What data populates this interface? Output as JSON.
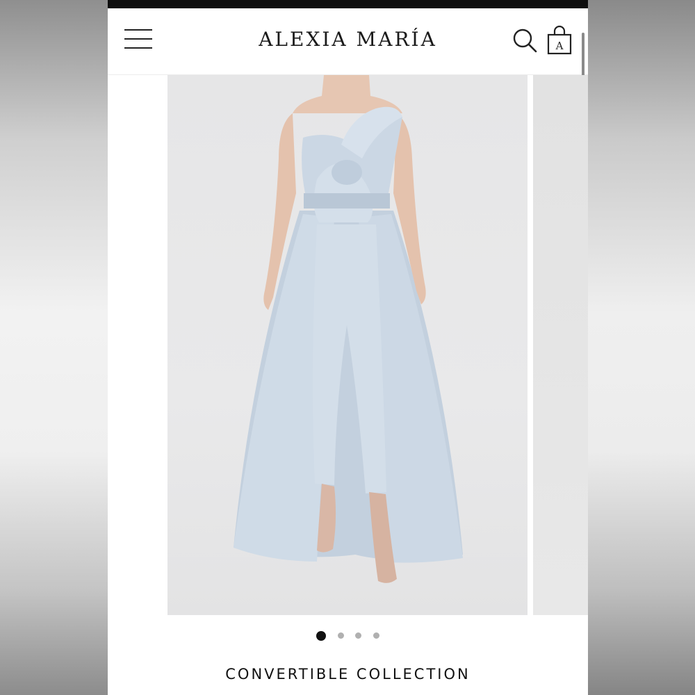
{
  "header": {
    "brand": "ALEXIA MARÍA",
    "menu_icon": "hamburger-menu-icon",
    "search_icon": "search-icon",
    "bag_icon": "shopping-bag-icon",
    "bag_logo_letter": "A"
  },
  "gallery": {
    "slide_count": 4,
    "active_slide": 1,
    "image_subject": "light blue strapless bow jumpsuit with detachable overskirt"
  },
  "collection": {
    "title": "CONVERTIBLE COLLECTION"
  },
  "colors": {
    "garment": "#c9d6e3",
    "background": "#e8e8e9",
    "text": "#111111"
  }
}
